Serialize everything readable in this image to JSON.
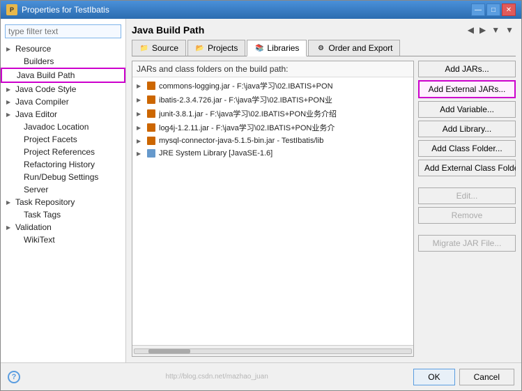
{
  "window": {
    "title": "Properties for TestIbatis",
    "icon": "P"
  },
  "titleButtons": [
    "—",
    "□",
    "✕"
  ],
  "leftPanel": {
    "filter": {
      "placeholder": "type filter text"
    },
    "items": [
      {
        "id": "resource",
        "label": "Resource",
        "hasArrow": true,
        "indent": 0
      },
      {
        "id": "builders",
        "label": "Builders",
        "hasArrow": false,
        "indent": 1
      },
      {
        "id": "java-build-path",
        "label": "Java Build Path",
        "hasArrow": false,
        "indent": 0,
        "selected": true
      },
      {
        "id": "java-code-style",
        "label": "Java Code Style",
        "hasArrow": true,
        "indent": 0
      },
      {
        "id": "java-compiler",
        "label": "Java Compiler",
        "hasArrow": true,
        "indent": 0
      },
      {
        "id": "java-editor",
        "label": "Java Editor",
        "hasArrow": true,
        "indent": 0
      },
      {
        "id": "javadoc-location",
        "label": "Javadoc Location",
        "hasArrow": false,
        "indent": 1
      },
      {
        "id": "project-facets",
        "label": "Project Facets",
        "hasArrow": false,
        "indent": 1
      },
      {
        "id": "project-references",
        "label": "Project References",
        "hasArrow": false,
        "indent": 1
      },
      {
        "id": "refactoring-history",
        "label": "Refactoring History",
        "hasArrow": false,
        "indent": 1
      },
      {
        "id": "run-debug-settings",
        "label": "Run/Debug Settings",
        "hasArrow": false,
        "indent": 1
      },
      {
        "id": "server",
        "label": "Server",
        "hasArrow": false,
        "indent": 1
      },
      {
        "id": "task-repository",
        "label": "Task Repository",
        "hasArrow": true,
        "indent": 0
      },
      {
        "id": "task-tags",
        "label": "Task Tags",
        "hasArrow": false,
        "indent": 1
      },
      {
        "id": "validation",
        "label": "Validation",
        "hasArrow": true,
        "indent": 0
      },
      {
        "id": "wikitext",
        "label": "WikiText",
        "hasArrow": false,
        "indent": 1
      }
    ]
  },
  "rightPanel": {
    "title": "Java Build Path",
    "tabs": [
      {
        "id": "source",
        "label": "Source",
        "active": false
      },
      {
        "id": "projects",
        "label": "Projects",
        "active": false
      },
      {
        "id": "libraries",
        "label": "Libraries",
        "active": true
      },
      {
        "id": "order-export",
        "label": "Order and Export",
        "active": false
      }
    ],
    "buildPathLabel": "JARs and class folders on the build path:",
    "jarItems": [
      {
        "label": "commons-logging.jar - F:\\java学习\\02.IBATIS+PON",
        "type": "jar"
      },
      {
        "label": "ibatis-2.3.4.726.jar - F:\\java学习\\02.IBATIS+PON业",
        "type": "jar"
      },
      {
        "label": "junit-3.8.1.jar - F:\\java学习\\02.IBATIS+PON业务介绍",
        "type": "jar"
      },
      {
        "label": "log4j-1.2.11.jar - F:\\java学习\\02.IBATIS+PON业务介",
        "type": "jar"
      },
      {
        "label": "mysql-connector-java-5.1.5-bin.jar - TestIbatis/lib",
        "type": "jar"
      },
      {
        "label": "JRE System Library [JavaSE-1.6]",
        "type": "lib"
      }
    ],
    "buttons": [
      {
        "id": "add-jars",
        "label": "Add JARs...",
        "disabled": false,
        "highlighted": false
      },
      {
        "id": "add-external-jars",
        "label": "Add External JARs...",
        "disabled": false,
        "highlighted": true
      },
      {
        "id": "add-variable",
        "label": "Add Variable...",
        "disabled": false,
        "highlighted": false
      },
      {
        "id": "add-library",
        "label": "Add Library...",
        "disabled": false,
        "highlighted": false
      },
      {
        "id": "add-class-folder",
        "label": "Add Class Folder...",
        "disabled": false,
        "highlighted": false
      },
      {
        "id": "add-external-class-folder",
        "label": "Add External Class Folder...",
        "disabled": false,
        "highlighted": false
      },
      {
        "id": "edit",
        "label": "Edit...",
        "disabled": true,
        "highlighted": false
      },
      {
        "id": "remove",
        "label": "Remove",
        "disabled": true,
        "highlighted": false
      },
      {
        "id": "migrate-jar",
        "label": "Migrate JAR File...",
        "disabled": true,
        "highlighted": false
      }
    ]
  },
  "bottomBar": {
    "watermark": "http://blog.csdn.net/mazhao_juan",
    "okLabel": "OK",
    "cancelLabel": "Cancel"
  }
}
